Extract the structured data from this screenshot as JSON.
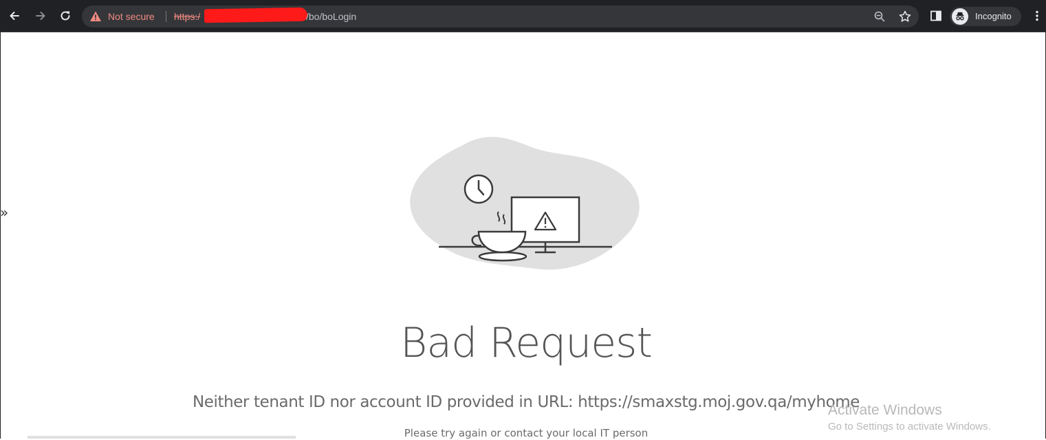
{
  "browser": {
    "security_label": "Not secure",
    "url_scheme": "https:/",
    "url_path": "/bo/boLogin",
    "profile_label": "Incognito",
    "icons": {
      "back": "arrow-left-icon",
      "forward": "arrow-right-icon",
      "reload": "reload-icon",
      "warning": "warning-triangle-icon",
      "zoom": "zoom-out-icon",
      "bookmark": "star-icon",
      "side_panel": "side-panel-icon",
      "incognito": "incognito-icon",
      "menu": "kebab-menu-icon"
    },
    "colors": {
      "toolbar": "#202124",
      "omnibox": "#35363a",
      "insecure": "#f28b82"
    }
  },
  "page": {
    "collapse_glyph": "»",
    "title": "Bad Request",
    "message": "Neither tenant ID nor account ID provided in URL: https://smaxstg.moj.gov.qa/myhome",
    "hint": "Please try again or contact your local IT person"
  },
  "watermark": {
    "title": "Activate Windows",
    "subtitle": "Go to Settings to activate Windows."
  }
}
